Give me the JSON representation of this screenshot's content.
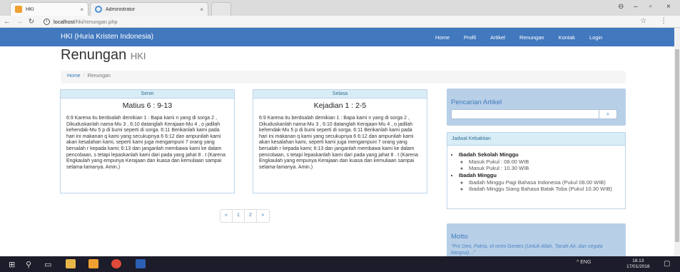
{
  "browser": {
    "tabs": [
      {
        "title": "HKI",
        "close": "×"
      },
      {
        "title": "Administrator",
        "close": "×"
      }
    ],
    "url_host": "localhost",
    "url_path": "/hki/renungan.php",
    "info_icon": "i",
    "window_controls": {
      "user": "⊖",
      "minimize": "–",
      "maximize": "▫",
      "close": "×"
    },
    "right_icons": "☆ ⋮"
  },
  "navbar": {
    "brand": "HKI (Huria Kristen Indonesia)",
    "links": [
      "Home",
      "Profil",
      "Artikel",
      "Renungan",
      "Kontak",
      "Login"
    ]
  },
  "page": {
    "title": "Renungan",
    "subtitle": "HKI",
    "breadcrumb": {
      "home": "Home",
      "sep": "/",
      "current": "Renungan"
    }
  },
  "cards": [
    {
      "day": "Senin",
      "reference": "Matius 6 : 9-13",
      "text": "6:9 Karena itu berdoalah demikian 1 : Bapa kami n yang di sorga 2 , Dikuduskanlah nama-Mu 3 , 6:10 datanglah Kerajaan-Mu 4 , o jadilah kehendak-Mu 5 p di bumi seperti di sorga. 6:11 Berikanlah kami pada hari ini makanan q kami yang secukupnya 6 6:12 dan ampunilah kami akan kesalahan kami, seperti kami juga mengampuni 7 orang yang bersalah r kepada kami; 6:13 dan janganlah membawa kami ke dalam pencobaan, s tetapi lepaskanlah kami dari pada yang jahat 8 . t (Karena Engkaulah yang empunya Kerajaan dan kuasa dan kemuliaan sampai selama-lamanya. Amin.)"
    },
    {
      "day": "Selasa",
      "reference": "Kejadian 1 : 2-5",
      "text": "6:9 Karena itu berdoalah demikian 1 : Bapa kami n yang di sorga 2 , Dikuduskanlah nama-Mu 3 , 6:10 datanglah Kerajaan-Mu 4 , o jadilah kehendak-Mu 5 p di bumi seperti di sorga. 6:11 Berikanlah kami pada hari ini makanan q kami yang secukupnya 6 6:12 dan ampunilah kami akan kesalahan kami, seperti kami juga mengampuni 7 orang yang bersalah r kepada kami; 6:13 dan janganlah membawa kami ke dalam pencobaan, s tetapi lepaskanlah kami dari pada yang jahat 8 . t (Karena Engkaulah yang empunya Kerajaan dan kuasa dan kemuliaan sampai selama-lamanya. Amin.)"
    }
  ],
  "pagination": {
    "prev": "«",
    "pages": [
      "1",
      "2"
    ],
    "next": "»"
  },
  "sidebar": {
    "search_title": "Pencarian Artikel",
    "search_placeholder": "",
    "search_button_icon": "⌕",
    "schedule_title": "Jadwal Kebaktian",
    "schedule": [
      {
        "name": "Ibadah Sekolah Minggu",
        "items": [
          "Masuk Pukul : 08.00 WIB",
          "Masuk Pukul : 10.30 WIB"
        ]
      },
      {
        "name": "Ibadah Minggu",
        "items": [
          "Ibadah Minggu Pagi Bahasa Indonesia (Pukul 08.00 WIB)",
          "Ibadah Minggu Siang Bahasa Batak Toba (Pukul 10.30 WIB)"
        ]
      }
    ],
    "motto_title": "Motto",
    "motto_text": "\"Pro Deo, Patria, et omni Gentes (Untuk Allah, Tanah Air, dan segala bangsa)...\""
  },
  "taskbar": {
    "tray_text": "^ ENG",
    "time": "18.13",
    "date": "17/01/2018"
  },
  "colors": {
    "navbar": "#4178be",
    "panel": "#b8cfe8",
    "panel_header": "#d9edf7",
    "link": "#337ab7"
  }
}
